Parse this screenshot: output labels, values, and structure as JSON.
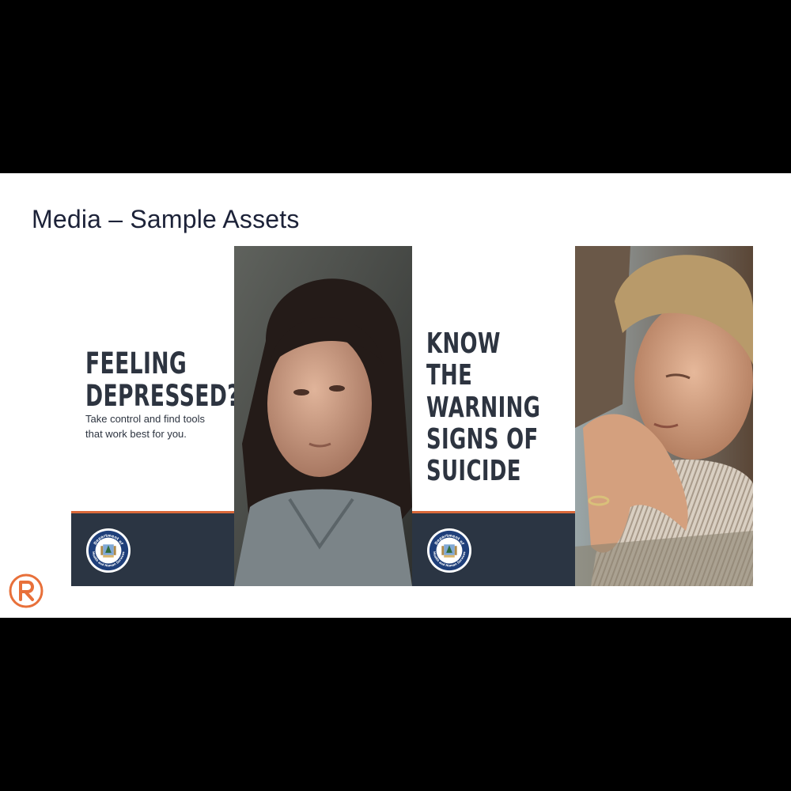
{
  "slide": {
    "title": "Media – Sample Assets"
  },
  "assets": [
    {
      "headline_lines": [
        "FEELING",
        "DEPRESSED?"
      ],
      "subtext_lines": [
        "Take control and find tools",
        "that work best for you."
      ]
    },
    {
      "headline_lines": [
        "KNOW THE",
        "WARNING",
        "SIGNS OF",
        "SUICIDE"
      ]
    }
  ],
  "seal": {
    "top_text": "Department of",
    "bottom_text": "Health and Human Services"
  },
  "icons": {
    "seal": "state-seal-icon",
    "corner_logo": "brand-logo-icon"
  },
  "colors": {
    "title": "#1c2238",
    "headline": "#2d3440",
    "footer_band": "#2b3543",
    "accent": "#d9693a",
    "logo": "#e8703a"
  }
}
